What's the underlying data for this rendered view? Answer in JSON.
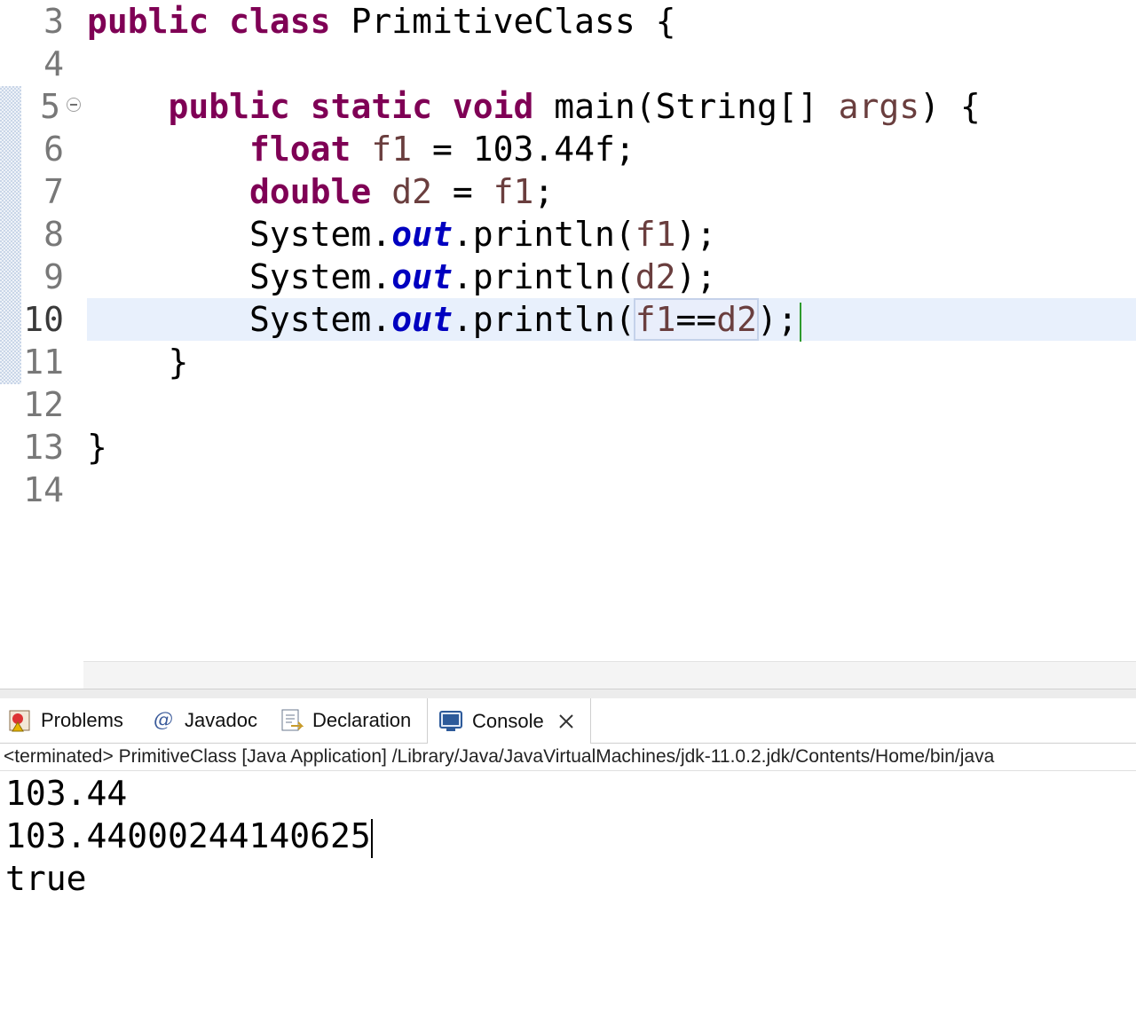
{
  "editor": {
    "lines": [
      {
        "n": "3"
      },
      {
        "n": "4"
      },
      {
        "n": "5"
      },
      {
        "n": "6"
      },
      {
        "n": "7"
      },
      {
        "n": "8"
      },
      {
        "n": "9"
      },
      {
        "n": "10"
      },
      {
        "n": "11"
      },
      {
        "n": "12"
      },
      {
        "n": "13"
      },
      {
        "n": "14"
      }
    ],
    "tokens": {
      "public": "public",
      "class": "class",
      "class_name": "PrimitiveClass",
      "open_brace": "{",
      "static": "static",
      "void": "void",
      "main_sig": "main(String[]",
      "args": "args",
      "close_paren_brace": ") {",
      "float": "float",
      "f1": "f1",
      "assign_float": "= 103.44f;",
      "double": "double",
      "d2": "d2",
      "eq": "=",
      "semi": ";",
      "system": "System.",
      "out": "out",
      "println": ".println(",
      "close_stmt": ");",
      "compare": "==",
      "close_brace": "}"
    }
  },
  "tabs": {
    "problems": "Problems",
    "javadoc": "Javadoc",
    "declaration": "Declaration",
    "console": "Console"
  },
  "console": {
    "command": "<terminated> PrimitiveClass [Java Application] /Library/Java/JavaVirtualMachines/jdk-11.0.2.jdk/Contents/Home/bin/java",
    "output": [
      "103.44",
      "103.44000244140625",
      "true"
    ]
  },
  "colors": {
    "keyword": "#7f0055",
    "variable": "#6a3e3e",
    "field": "#0000c0",
    "current_line": "#e8f0fc"
  }
}
